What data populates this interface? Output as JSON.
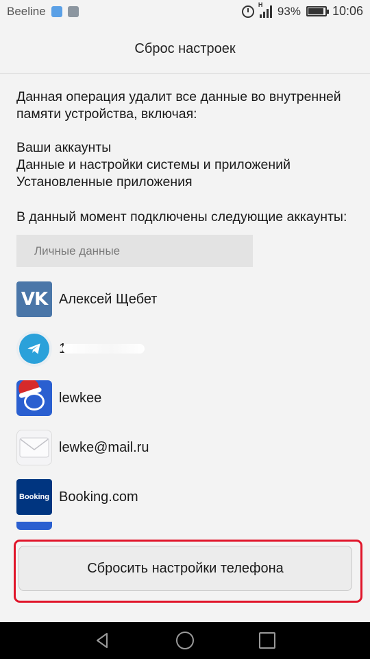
{
  "status_bar": {
    "carrier": "Beeline",
    "battery": "93%",
    "time": "10:06",
    "signal_type": "H"
  },
  "header": {
    "title": "Сброс настроек"
  },
  "content": {
    "intro": "Данная операция удалит все данные во внутренней памяти устройства, включая:",
    "items": [
      "Ваши аккаунты",
      "Данные и настройки системы и приложений",
      "Установленные приложения"
    ],
    "accounts_intro": "В данный момент подключены следующие аккаунты:",
    "section_label": "Личные данные",
    "accounts": [
      {
        "name": "Алексей Щебет",
        "icon": "vk-icon",
        "icon_text": "VK"
      },
      {
        "name": "1",
        "icon": "telegram-icon",
        "redacted": true
      },
      {
        "name": "lewkee",
        "icon": "lewkee-app-icon"
      },
      {
        "name": "lewke@mail.ru",
        "icon": "email-icon"
      },
      {
        "name": "Booking.com",
        "icon": "booking-icon",
        "icon_text": "Booking"
      }
    ]
  },
  "reset_button": {
    "label": "Сбросить настройки телефона"
  },
  "colors": {
    "highlight": "#e0152a",
    "vk": "#4a76a8",
    "telegram": "#2aa1da",
    "booking": "#003580"
  }
}
